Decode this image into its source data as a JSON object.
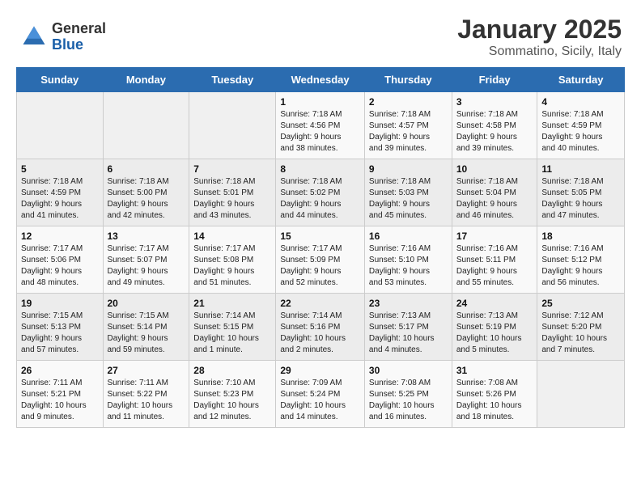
{
  "header": {
    "logo_general": "General",
    "logo_blue": "Blue",
    "month_title": "January 2025",
    "location": "Sommatino, Sicily, Italy"
  },
  "days_of_week": [
    "Sunday",
    "Monday",
    "Tuesday",
    "Wednesday",
    "Thursday",
    "Friday",
    "Saturday"
  ],
  "weeks": [
    [
      {
        "day": "",
        "info": ""
      },
      {
        "day": "",
        "info": ""
      },
      {
        "day": "",
        "info": ""
      },
      {
        "day": "1",
        "info": "Sunrise: 7:18 AM\nSunset: 4:56 PM\nDaylight: 9 hours\nand 38 minutes."
      },
      {
        "day": "2",
        "info": "Sunrise: 7:18 AM\nSunset: 4:57 PM\nDaylight: 9 hours\nand 39 minutes."
      },
      {
        "day": "3",
        "info": "Sunrise: 7:18 AM\nSunset: 4:58 PM\nDaylight: 9 hours\nand 39 minutes."
      },
      {
        "day": "4",
        "info": "Sunrise: 7:18 AM\nSunset: 4:59 PM\nDaylight: 9 hours\nand 40 minutes."
      }
    ],
    [
      {
        "day": "5",
        "info": "Sunrise: 7:18 AM\nSunset: 4:59 PM\nDaylight: 9 hours\nand 41 minutes."
      },
      {
        "day": "6",
        "info": "Sunrise: 7:18 AM\nSunset: 5:00 PM\nDaylight: 9 hours\nand 42 minutes."
      },
      {
        "day": "7",
        "info": "Sunrise: 7:18 AM\nSunset: 5:01 PM\nDaylight: 9 hours\nand 43 minutes."
      },
      {
        "day": "8",
        "info": "Sunrise: 7:18 AM\nSunset: 5:02 PM\nDaylight: 9 hours\nand 44 minutes."
      },
      {
        "day": "9",
        "info": "Sunrise: 7:18 AM\nSunset: 5:03 PM\nDaylight: 9 hours\nand 45 minutes."
      },
      {
        "day": "10",
        "info": "Sunrise: 7:18 AM\nSunset: 5:04 PM\nDaylight: 9 hours\nand 46 minutes."
      },
      {
        "day": "11",
        "info": "Sunrise: 7:18 AM\nSunset: 5:05 PM\nDaylight: 9 hours\nand 47 minutes."
      }
    ],
    [
      {
        "day": "12",
        "info": "Sunrise: 7:17 AM\nSunset: 5:06 PM\nDaylight: 9 hours\nand 48 minutes."
      },
      {
        "day": "13",
        "info": "Sunrise: 7:17 AM\nSunset: 5:07 PM\nDaylight: 9 hours\nand 49 minutes."
      },
      {
        "day": "14",
        "info": "Sunrise: 7:17 AM\nSunset: 5:08 PM\nDaylight: 9 hours\nand 51 minutes."
      },
      {
        "day": "15",
        "info": "Sunrise: 7:17 AM\nSunset: 5:09 PM\nDaylight: 9 hours\nand 52 minutes."
      },
      {
        "day": "16",
        "info": "Sunrise: 7:16 AM\nSunset: 5:10 PM\nDaylight: 9 hours\nand 53 minutes."
      },
      {
        "day": "17",
        "info": "Sunrise: 7:16 AM\nSunset: 5:11 PM\nDaylight: 9 hours\nand 55 minutes."
      },
      {
        "day": "18",
        "info": "Sunrise: 7:16 AM\nSunset: 5:12 PM\nDaylight: 9 hours\nand 56 minutes."
      }
    ],
    [
      {
        "day": "19",
        "info": "Sunrise: 7:15 AM\nSunset: 5:13 PM\nDaylight: 9 hours\nand 57 minutes."
      },
      {
        "day": "20",
        "info": "Sunrise: 7:15 AM\nSunset: 5:14 PM\nDaylight: 9 hours\nand 59 minutes."
      },
      {
        "day": "21",
        "info": "Sunrise: 7:14 AM\nSunset: 5:15 PM\nDaylight: 10 hours\nand 1 minute."
      },
      {
        "day": "22",
        "info": "Sunrise: 7:14 AM\nSunset: 5:16 PM\nDaylight: 10 hours\nand 2 minutes."
      },
      {
        "day": "23",
        "info": "Sunrise: 7:13 AM\nSunset: 5:17 PM\nDaylight: 10 hours\nand 4 minutes."
      },
      {
        "day": "24",
        "info": "Sunrise: 7:13 AM\nSunset: 5:19 PM\nDaylight: 10 hours\nand 5 minutes."
      },
      {
        "day": "25",
        "info": "Sunrise: 7:12 AM\nSunset: 5:20 PM\nDaylight: 10 hours\nand 7 minutes."
      }
    ],
    [
      {
        "day": "26",
        "info": "Sunrise: 7:11 AM\nSunset: 5:21 PM\nDaylight: 10 hours\nand 9 minutes."
      },
      {
        "day": "27",
        "info": "Sunrise: 7:11 AM\nSunset: 5:22 PM\nDaylight: 10 hours\nand 11 minutes."
      },
      {
        "day": "28",
        "info": "Sunrise: 7:10 AM\nSunset: 5:23 PM\nDaylight: 10 hours\nand 12 minutes."
      },
      {
        "day": "29",
        "info": "Sunrise: 7:09 AM\nSunset: 5:24 PM\nDaylight: 10 hours\nand 14 minutes."
      },
      {
        "day": "30",
        "info": "Sunrise: 7:08 AM\nSunset: 5:25 PM\nDaylight: 10 hours\nand 16 minutes."
      },
      {
        "day": "31",
        "info": "Sunrise: 7:08 AM\nSunset: 5:26 PM\nDaylight: 10 hours\nand 18 minutes."
      },
      {
        "day": "",
        "info": ""
      }
    ]
  ]
}
